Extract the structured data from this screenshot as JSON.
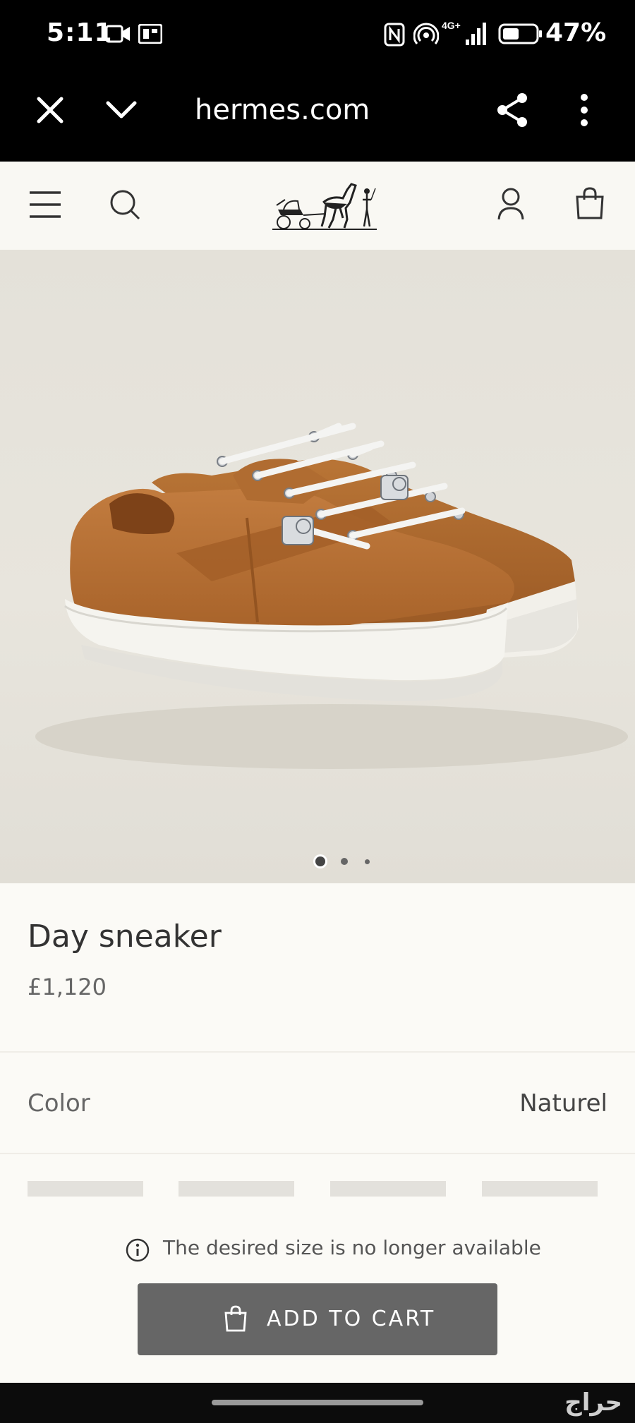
{
  "status_bar": {
    "time": "5:11",
    "signal_label": "4G+",
    "battery": "47%"
  },
  "browser": {
    "url": "hermes.com",
    "icons": [
      "close-icon",
      "chevron-down-icon",
      "share-icon",
      "more-vert-icon"
    ]
  },
  "header": {
    "icons": [
      "menu-icon",
      "search-icon",
      "hermes-carriage-logo",
      "account-icon",
      "shopping-bag-icon"
    ]
  },
  "gallery": {
    "image_count": 3,
    "active_index": 0
  },
  "product": {
    "title": "Day sneaker",
    "price": "£1,120"
  },
  "color": {
    "label": "Color",
    "value": "Naturel"
  },
  "sizes": {
    "swatch_count": 4
  },
  "notice": {
    "text": "The desired size is no longer available",
    "icon": "info-icon"
  },
  "cart": {
    "label": "ADD TO CART",
    "icon": "shopping-bag-icon"
  },
  "watermark": {
    "text": "حراج"
  },
  "colors": {
    "page_bg": "#fbfaf6",
    "header_bg": "#f9f8f3",
    "image_bg": "#e6e3db",
    "leather": "#b8733a",
    "button_bg": "#666666"
  }
}
